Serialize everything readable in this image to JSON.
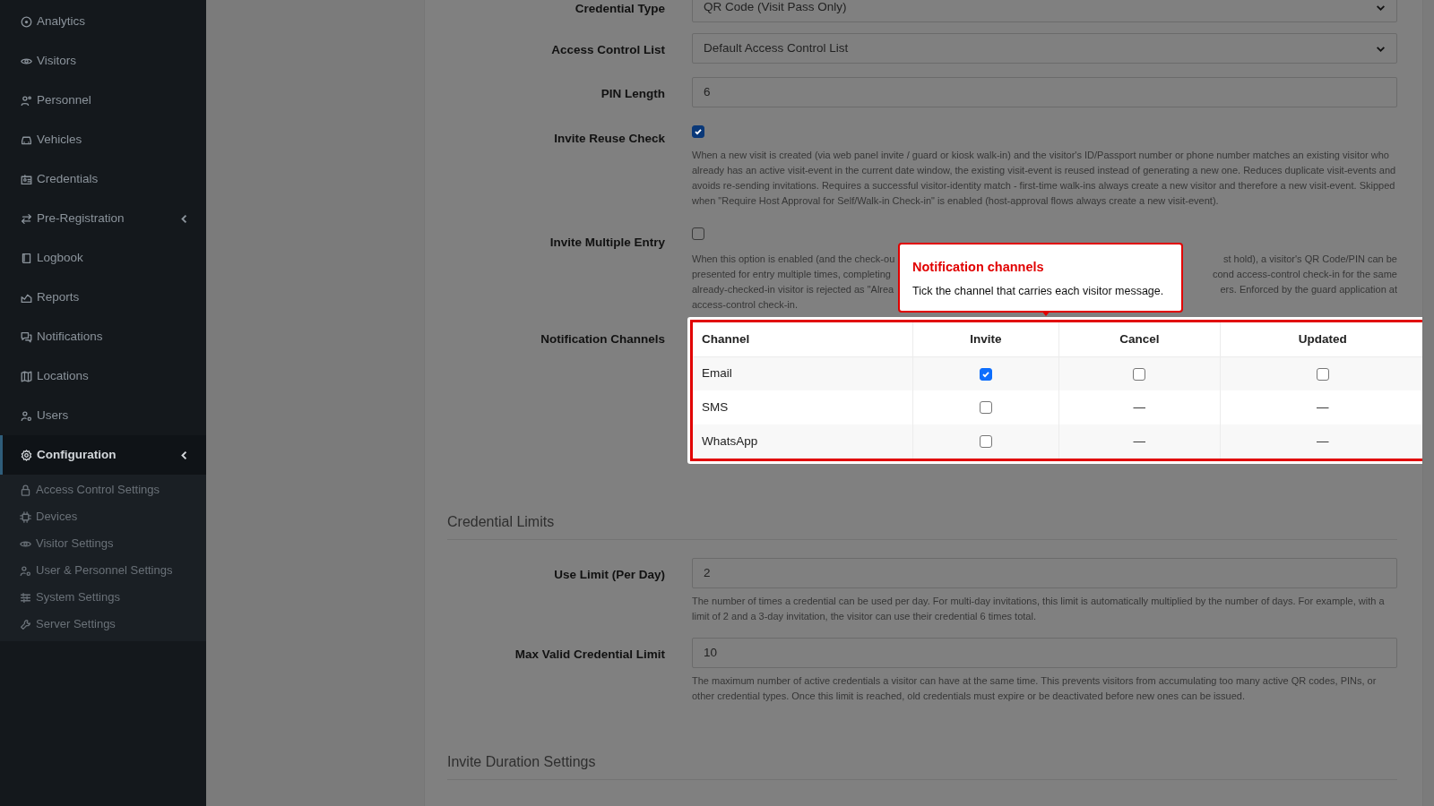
{
  "sidebar": {
    "items": [
      {
        "label": "Analytics",
        "kind": "link",
        "selected": false
      },
      {
        "label": "Visitors",
        "kind": "link",
        "selected": false
      },
      {
        "label": "Personnel",
        "kind": "link",
        "selected": false
      },
      {
        "label": "Vehicles",
        "kind": "link",
        "selected": false
      },
      {
        "label": "Credentials",
        "kind": "link",
        "selected": false
      },
      {
        "label": "Pre-Registration",
        "kind": "group",
        "selected": false
      },
      {
        "label": "Logbook",
        "kind": "link",
        "selected": false
      },
      {
        "label": "Reports",
        "kind": "link",
        "selected": false
      },
      {
        "label": "Notifications",
        "kind": "link",
        "selected": false
      },
      {
        "label": "Locations",
        "kind": "link",
        "selected": false
      },
      {
        "label": "Users",
        "kind": "link",
        "selected": false
      },
      {
        "label": "Configuration",
        "kind": "group",
        "selected": true,
        "children": [
          {
            "label": "Access Control Settings"
          },
          {
            "label": "Devices"
          },
          {
            "label": "Visitor Settings"
          },
          {
            "label": "User & Personnel Settings"
          },
          {
            "label": "System Settings"
          },
          {
            "label": "Server Settings"
          }
        ]
      }
    ]
  },
  "sections": [
    {
      "fields": [
        {
          "kind": "select",
          "label": "Credential Type",
          "value": "QR Code (Visit Pass Only)"
        },
        {
          "kind": "select",
          "label": "Access Control List",
          "value": "Default Access Control List"
        },
        {
          "kind": "input",
          "label": "PIN Length",
          "value": "6"
        },
        {
          "kind": "checkbox",
          "label": "Invite Reuse Check",
          "checked": true,
          "help": "When a new visit is created (via web panel invite / guard or kiosk walk-in) and the visitor's ID/Passport number or phone number matches an existing visitor who already has an active visit-event in the current date window, the existing visit-event is reused instead of generating a new one. Reduces duplicate visit-events and avoids re-sending invitations. Requires a successful visitor-identity match - first-time walk-ins always create a new visitor and therefore a new visit-event. Skipped when \"Require Host Approval for Self/Walk-in Check-in\" is enabled (host-approval flows always create a new visit-event)."
        },
        {
          "kind": "checkbox",
          "label": "Invite Multiple Entry",
          "checked": false,
          "help_lines": [
            {
              "left": "When this option is enabled (and the check-ou",
              "right": "st hold), a visitor's QR Code/PIN can be"
            },
            {
              "left": "presented for entry multiple times, completing",
              "right": "cond access-control check-in for the same"
            },
            {
              "left": "already-checked-in visitor is rejected as \"Alrea",
              "right": "ers. Enforced by the guard application at"
            },
            {
              "left": "access-control check-in."
            }
          ]
        },
        {
          "kind": "channel_table",
          "label": "Notification Channels",
          "columns": [
            "Channel",
            "Invite",
            "Cancel",
            "Updated"
          ],
          "rows": [
            {
              "cells": [
                {
                  "kind": "text",
                  "text": "Email"
                },
                {
                  "kind": "checkbox",
                  "checked": true
                },
                {
                  "kind": "checkbox",
                  "checked": false
                },
                {
                  "kind": "checkbox",
                  "checked": false
                }
              ]
            },
            {
              "cells": [
                {
                  "kind": "text",
                  "text": "SMS"
                },
                {
                  "kind": "checkbox",
                  "checked": false
                },
                {
                  "kind": "dash",
                  "text": "—"
                },
                {
                  "kind": "dash",
                  "text": "—"
                }
              ]
            },
            {
              "cells": [
                {
                  "kind": "text",
                  "text": "WhatsApp"
                },
                {
                  "kind": "checkbox",
                  "checked": false
                },
                {
                  "kind": "dash",
                  "text": "—"
                },
                {
                  "kind": "dash",
                  "text": "—"
                }
              ]
            }
          ],
          "tooltip": {
            "title": "Notification channels",
            "text": "Tick the channel that carries each visitor message."
          }
        }
      ]
    },
    {
      "heading": "Credential Limits",
      "fields": [
        {
          "kind": "input",
          "label": "Use Limit (Per Day)",
          "value": "2",
          "help": "The number of times a credential can be used per day. For multi-day invitations, this limit is automatically multiplied by the number of days. For example, with a limit of 2 and a 3-day invitation, the visitor can use their credential 6 times total."
        },
        {
          "kind": "input",
          "label": "Max Valid Credential Limit",
          "value": "10",
          "help": "The maximum number of active credentials a visitor can have at the same time. This prevents visitors from accumulating too many active QR codes, PINs, or other credential types. Once this limit is reached, old credentials must expire or be deactivated before new ones can be issued."
        }
      ]
    },
    {
      "heading": "Invite Duration Settings"
    }
  ]
}
